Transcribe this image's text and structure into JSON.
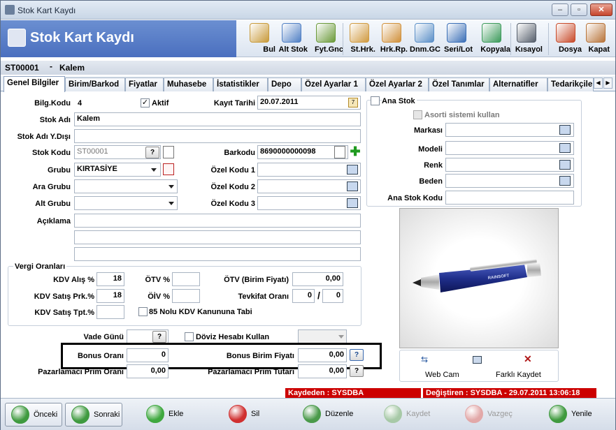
{
  "window": {
    "title": "Stok Kart Kaydı",
    "min": "–",
    "max": "▫",
    "close": "✕"
  },
  "header": {
    "title": "Stok Kart Kaydı"
  },
  "toolbar": [
    {
      "label": "Bul",
      "icon": "search-icon",
      "color": "#c89a3a"
    },
    {
      "label": "Alt Stok",
      "icon": "network-icon",
      "color": "#4f7fc4"
    },
    {
      "label": "Fyt.Gnc",
      "icon": "coins-icon",
      "color": "#6b9a3a"
    },
    {
      "label": "St.Hrk.",
      "icon": "boxes-icon",
      "color": "#d09a40"
    },
    {
      "label": "Hrk.Rp.",
      "icon": "report-icon",
      "color": "#d0903a"
    },
    {
      "label": "Dnm.GC",
      "icon": "document-refresh-icon",
      "color": "#5a8fc7"
    },
    {
      "label": "Seri/Lot",
      "icon": "serial-list-icon",
      "color": "#3b6fb7"
    },
    {
      "label": "Kopyala",
      "icon": "copy-icon",
      "color": "#3b9a5a"
    },
    {
      "label": "Kısayol",
      "icon": "keyboard-icon",
      "color": "#555e6b"
    },
    {
      "label": "Dosya",
      "icon": "folder-icon",
      "color": "#c84a2a"
    },
    {
      "label": "Kapat",
      "icon": "exit-door-icon",
      "color": "#b8743a"
    }
  ],
  "record": {
    "code": "ST00001",
    "dash": "-",
    "name": "Kalem"
  },
  "tabs": [
    "Genel Bilgiler",
    "Birim/Barkod",
    "Fiyatlar",
    "Muhasebe",
    "İstatistikler",
    "Depo",
    "Özel Ayarlar 1",
    "Özel Ayarlar 2",
    "Özel Tanımlar",
    "Alternatifler",
    "Tedarikçile"
  ],
  "form": {
    "bilg_kodu_label": "Bilg.Kodu",
    "bilg_kodu_value": "4",
    "aktif_label": "Aktif",
    "aktif_checked": "✓",
    "kayit_tarihi_label": "Kayıt Tarihi",
    "kayit_tarihi_value": "20.07.2011",
    "stok_adi_label": "Stok Adı",
    "stok_adi_value": "Kalem",
    "stok_adi_yd_label": "Stok Adı Y.Dışı",
    "stok_adi_yd_value": "",
    "stok_kodu_label": "Stok Kodu",
    "stok_kodu_value": "ST00001",
    "barkodu_label": "Barkodu",
    "barkodu_value": "8690000000098",
    "grubu_label": "Grubu",
    "grubu_value": "KIRTASİYE",
    "ozel1_label": "Özel Kodu 1",
    "ozel2_label": "Özel Kodu 2",
    "ozel3_label": "Özel Kodu 3",
    "ara_grubu_label": "Ara Grubu",
    "alt_grubu_label": "Alt Grubu",
    "aciklama_label": "Açıklama",
    "help": "?"
  },
  "right": {
    "ana_stok_label": "Ana Stok",
    "asorti_label": "Asorti sistemi kullan",
    "markasi_label": "Markası",
    "modeli_label": "Modeli",
    "renk_label": "Renk",
    "beden_label": "Beden",
    "ana_stok_kodu_label": "Ana Stok Kodu",
    "image_text": "RAINSOFT",
    "webcam_label": "Web Cam",
    "farkli_label": "Farklı Kaydet"
  },
  "vergi": {
    "title": "Vergi Oranları",
    "kdv_alis_label": "KDV Alış %",
    "kdv_alis_value": "18",
    "kdv_satis_prk_label": "KDV Satış Prk.%",
    "kdv_satis_prk_value": "18",
    "kdv_satis_tpt_label": "KDV Satış Tpt.%",
    "kdv_satis_tpt_value": "",
    "otv_label": "ÖTV %",
    "oiv_label": "ÖİV %",
    "otv_birim_label": "ÖTV (Birim Fiyatı)",
    "otv_birim_value": "0,00",
    "tevkifat_label": "Tevkifat Oranı",
    "tevkifat_a": "0",
    "tevkifat_sep": "/",
    "tevkifat_b": "0",
    "kanun_label": "85 Nolu KDV Kanununa Tabi"
  },
  "misc": {
    "vade_label": "Vade Günü",
    "doviz_label": "Döviz Hesabı Kullan",
    "bonus_orani_label": "Bonus Oranı",
    "bonus_orani_value": "0",
    "bonus_birim_label": "Bonus Birim Fiyatı",
    "bonus_birim_value": "0,00",
    "paz_prim_orani_label": "Pazarlamacı Prim Oranı",
    "paz_prim_orani_value": "0,00",
    "paz_prim_tutari_label": "Pazarlamacı Prim Tutarı",
    "paz_prim_tutari_value": "0,00"
  },
  "status": {
    "kaydeden": "Kaydeden : SYSDBA",
    "degistiren": "Değiştiren : SYSDBA - 29.07.2011 13:06:18"
  },
  "bottom": [
    {
      "label": "Önceki",
      "color": "#3f9a3f",
      "enabled": true
    },
    {
      "label": "Sonraki",
      "color": "#3f9a3f",
      "enabled": true
    },
    {
      "label": "Ekle",
      "color": "#3fa83f",
      "enabled": true
    },
    {
      "label": "Sil",
      "color": "#d03030",
      "enabled": true
    },
    {
      "label": "Düzenle",
      "color": "#4a9a4a",
      "enabled": true
    },
    {
      "label": "Kaydet",
      "color": "#a7c9a7",
      "enabled": false
    },
    {
      "label": "Vazgeç",
      "color": "#e2a8a8",
      "enabled": false
    },
    {
      "label": "Yenile",
      "color": "#3f9a3f",
      "enabled": true
    }
  ]
}
